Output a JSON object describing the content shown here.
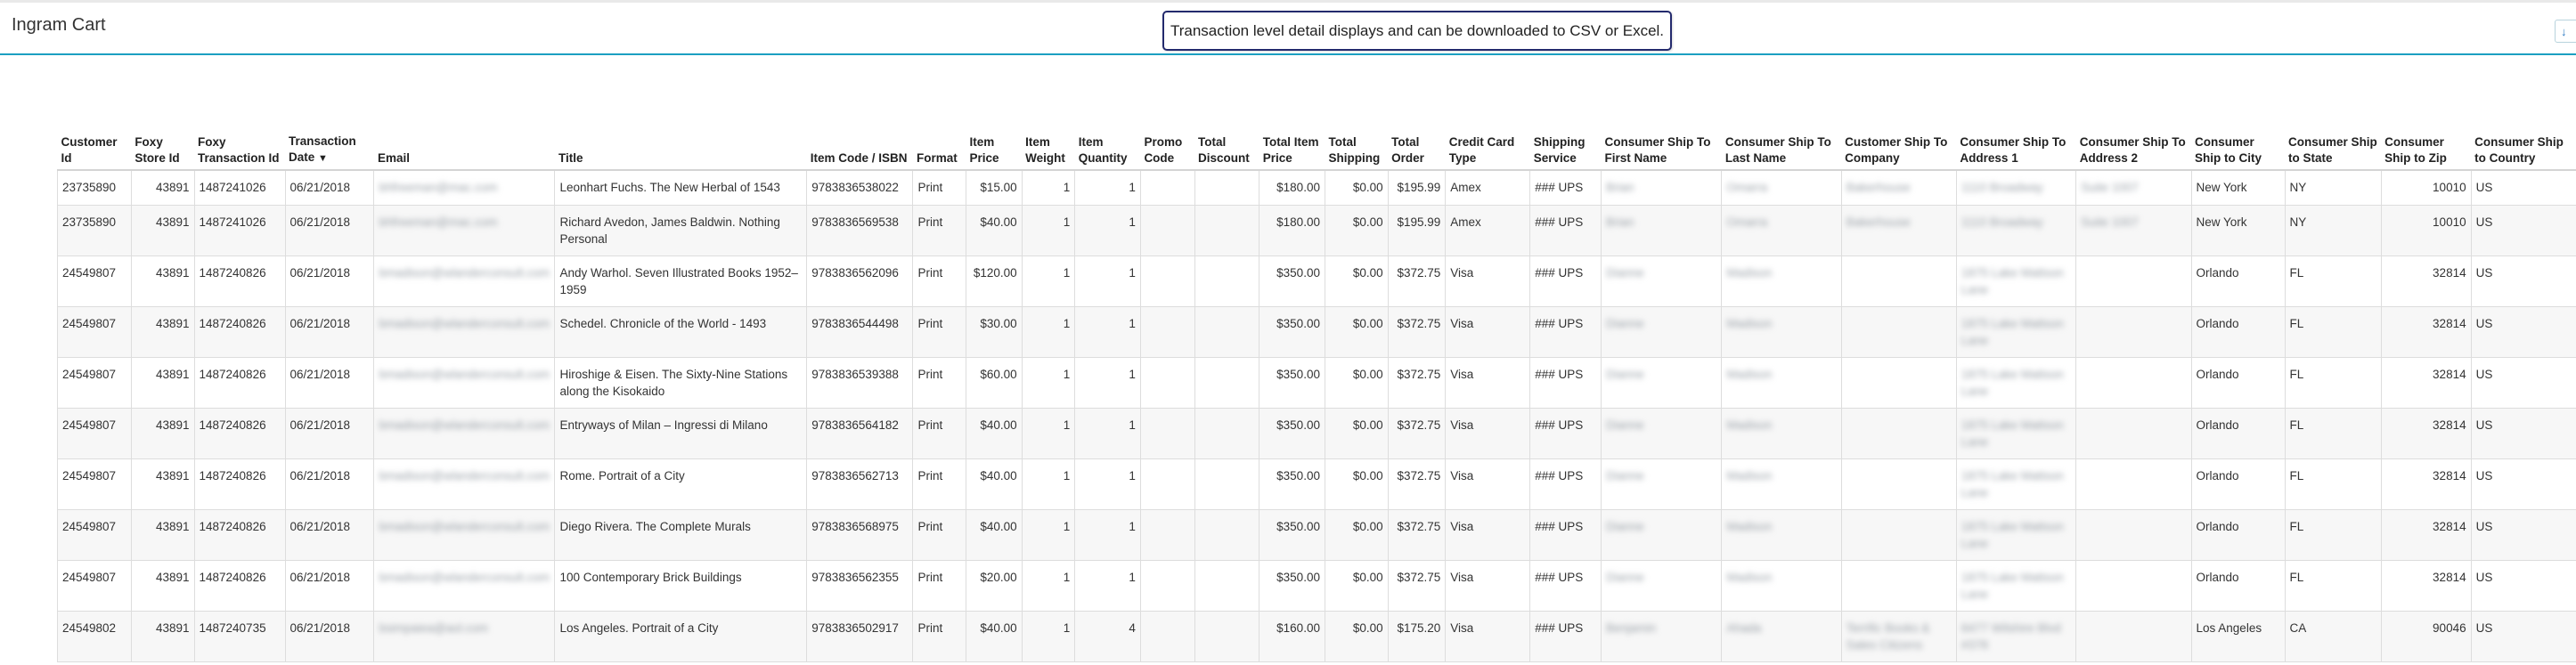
{
  "app": {
    "title": "Ingram Cart"
  },
  "callout": {
    "text": "Transaction level detail displays and can be  downloaded to CSV or Excel."
  },
  "edge_button": {
    "label": "↓"
  },
  "table": {
    "columns": [
      {
        "key": "customer_id",
        "label": "Customer Id",
        "align": "left"
      },
      {
        "key": "store_id",
        "label": "Foxy Store Id",
        "align": "right"
      },
      {
        "key": "txn_id",
        "label": "Foxy Transaction Id",
        "align": "left"
      },
      {
        "key": "txn_date",
        "label": "Transaction Date",
        "align": "left",
        "sort": "▼"
      },
      {
        "key": "email",
        "label": "Email",
        "align": "left",
        "blur": true
      },
      {
        "key": "title",
        "label": "Title",
        "align": "left"
      },
      {
        "key": "isbn",
        "label": "Item Code / ISBN",
        "align": "left"
      },
      {
        "key": "format",
        "label": "Format",
        "align": "left"
      },
      {
        "key": "item_price",
        "label": "Item Price",
        "align": "right"
      },
      {
        "key": "item_weight",
        "label": "Item Weight",
        "align": "right"
      },
      {
        "key": "item_qty",
        "label": "Item Quantity",
        "align": "right"
      },
      {
        "key": "promo",
        "label": "Promo Code",
        "align": "left"
      },
      {
        "key": "discount",
        "label": "Total Discount",
        "align": "left"
      },
      {
        "key": "total_item_price",
        "label": "Total Item Price",
        "align": "right"
      },
      {
        "key": "total_shipping",
        "label": "Total Shipping",
        "align": "right"
      },
      {
        "key": "total_order",
        "label": "Total Order",
        "align": "right"
      },
      {
        "key": "card_type",
        "label": "Credit Card Type",
        "align": "left"
      },
      {
        "key": "ship_service",
        "label": "Shipping Service",
        "align": "left"
      },
      {
        "key": "first_name",
        "label": "Consumer Ship To First Name",
        "align": "left",
        "blur": true
      },
      {
        "key": "last_name",
        "label": "Consumer Ship To Last Name",
        "align": "left",
        "blur": true
      },
      {
        "key": "company",
        "label": "Customer Ship To Company",
        "align": "left",
        "blur": true
      },
      {
        "key": "address1",
        "label": "Consumer Ship To Address 1",
        "align": "left",
        "blur": true
      },
      {
        "key": "address2",
        "label": "Consumer Ship To Address 2",
        "align": "left",
        "blur": true
      },
      {
        "key": "city",
        "label": "Consumer Ship to City",
        "align": "left"
      },
      {
        "key": "state",
        "label": "Consumer Ship to State",
        "align": "left"
      },
      {
        "key": "zip",
        "label": "Consumer Ship to Zip",
        "align": "right"
      },
      {
        "key": "country",
        "label": "Consumer Ship to Country",
        "align": "left"
      }
    ],
    "rows": [
      {
        "short": true,
        "customer_id": "23735890",
        "store_id": "43891",
        "txn_id": "1487241026",
        "txn_date": "06/21/2018",
        "email": "bhfreeman@mac.com",
        "title": "Leonhart Fuchs. The New Herbal of 1543",
        "isbn": "9783836538022",
        "format": "Print",
        "item_price": "$15.00",
        "item_weight": "1",
        "item_qty": "1",
        "promo": "",
        "discount": "",
        "total_item_price": "$180.00",
        "total_shipping": "$0.00",
        "total_order": "$195.99",
        "card_type": "Amex",
        "ship_service": "### UPS",
        "first_name": "Brian",
        "last_name": "Omarra",
        "company": "Bakerhouse",
        "address1": "1110 Broadway",
        "address2": "Suite 1007",
        "city": "New York",
        "state": "NY",
        "zip": "10010",
        "country": "US"
      },
      {
        "short": false,
        "customer_id": "23735890",
        "store_id": "43891",
        "txn_id": "1487241026",
        "txn_date": "06/21/2018",
        "email": "bhfreeman@mac.com",
        "title": "Richard Avedon, James Baldwin. Nothing Personal",
        "isbn": "9783836569538",
        "format": "Print",
        "item_price": "$40.00",
        "item_weight": "1",
        "item_qty": "1",
        "promo": "",
        "discount": "",
        "total_item_price": "$180.00",
        "total_shipping": "$0.00",
        "total_order": "$195.99",
        "card_type": "Amex",
        "ship_service": "### UPS",
        "first_name": "Brian",
        "last_name": "Omarra",
        "company": "Bakerhouse",
        "address1": "1110 Broadway",
        "address2": "Suite 1007",
        "city": "New York",
        "state": "NY",
        "zip": "10010",
        "country": "US"
      },
      {
        "short": false,
        "customer_id": "24549807",
        "store_id": "43891",
        "txn_id": "1487240826",
        "txn_date": "06/21/2018",
        "email": "bmadison@wlanderconsult.com",
        "title": "Andy Warhol. Seven Illustrated Books 1952–1959",
        "isbn": "9783836562096",
        "format": "Print",
        "item_price": "$120.00",
        "item_weight": "1",
        "item_qty": "1",
        "promo": "",
        "discount": "",
        "total_item_price": "$350.00",
        "total_shipping": "$0.00",
        "total_order": "$372.75",
        "card_type": "Visa",
        "ship_service": "### UPS",
        "first_name": "Dianne",
        "last_name": "Madison",
        "company": "",
        "address1": "1875 Lake Mattson Lane",
        "address2": "",
        "city": "Orlando",
        "state": "FL",
        "zip": "32814",
        "country": "US"
      },
      {
        "short": false,
        "customer_id": "24549807",
        "store_id": "43891",
        "txn_id": "1487240826",
        "txn_date": "06/21/2018",
        "email": "bmadison@wlanderconsult.com",
        "title": "Schedel. Chronicle of the World - 1493",
        "isbn": "9783836544498",
        "format": "Print",
        "item_price": "$30.00",
        "item_weight": "1",
        "item_qty": "1",
        "promo": "",
        "discount": "",
        "total_item_price": "$350.00",
        "total_shipping": "$0.00",
        "total_order": "$372.75",
        "card_type": "Visa",
        "ship_service": "### UPS",
        "first_name": "Dianne",
        "last_name": "Madison",
        "company": "",
        "address1": "1875 Lake Mattson Lane",
        "address2": "",
        "city": "Orlando",
        "state": "FL",
        "zip": "32814",
        "country": "US"
      },
      {
        "short": false,
        "customer_id": "24549807",
        "store_id": "43891",
        "txn_id": "1487240826",
        "txn_date": "06/21/2018",
        "email": "bmadison@wlanderconsult.com",
        "title": "Hiroshige & Eisen. The Sixty-Nine Stations along the Kisokaido",
        "isbn": "9783836539388",
        "format": "Print",
        "item_price": "$60.00",
        "item_weight": "1",
        "item_qty": "1",
        "promo": "",
        "discount": "",
        "total_item_price": "$350.00",
        "total_shipping": "$0.00",
        "total_order": "$372.75",
        "card_type": "Visa",
        "ship_service": "### UPS",
        "first_name": "Dianne",
        "last_name": "Madison",
        "company": "",
        "address1": "1875 Lake Mattson Lane",
        "address2": "",
        "city": "Orlando",
        "state": "FL",
        "zip": "32814",
        "country": "US"
      },
      {
        "short": false,
        "customer_id": "24549807",
        "store_id": "43891",
        "txn_id": "1487240826",
        "txn_date": "06/21/2018",
        "email": "bmadison@wlanderconsult.com",
        "title": "Entryways of Milan – Ingressi di Milano",
        "isbn": "9783836564182",
        "format": "Print",
        "item_price": "$40.00",
        "item_weight": "1",
        "item_qty": "1",
        "promo": "",
        "discount": "",
        "total_item_price": "$350.00",
        "total_shipping": "$0.00",
        "total_order": "$372.75",
        "card_type": "Visa",
        "ship_service": "### UPS",
        "first_name": "Dianne",
        "last_name": "Madison",
        "company": "",
        "address1": "1875 Lake Mattson Lane",
        "address2": "",
        "city": "Orlando",
        "state": "FL",
        "zip": "32814",
        "country": "US"
      },
      {
        "short": false,
        "customer_id": "24549807",
        "store_id": "43891",
        "txn_id": "1487240826",
        "txn_date": "06/21/2018",
        "email": "bmadison@wlanderconsult.com",
        "title": "Rome. Portrait of a City",
        "isbn": "9783836562713",
        "format": "Print",
        "item_price": "$40.00",
        "item_weight": "1",
        "item_qty": "1",
        "promo": "",
        "discount": "",
        "total_item_price": "$350.00",
        "total_shipping": "$0.00",
        "total_order": "$372.75",
        "card_type": "Visa",
        "ship_service": "### UPS",
        "first_name": "Dianne",
        "last_name": "Madison",
        "company": "",
        "address1": "1875 Lake Mattson Lane",
        "address2": "",
        "city": "Orlando",
        "state": "FL",
        "zip": "32814",
        "country": "US"
      },
      {
        "short": false,
        "customer_id": "24549807",
        "store_id": "43891",
        "txn_id": "1487240826",
        "txn_date": "06/21/2018",
        "email": "bmadison@wlanderconsult.com",
        "title": "Diego Rivera. The Complete Murals",
        "isbn": "9783836568975",
        "format": "Print",
        "item_price": "$40.00",
        "item_weight": "1",
        "item_qty": "1",
        "promo": "",
        "discount": "",
        "total_item_price": "$350.00",
        "total_shipping": "$0.00",
        "total_order": "$372.75",
        "card_type": "Visa",
        "ship_service": "### UPS",
        "first_name": "Dianne",
        "last_name": "Madison",
        "company": "",
        "address1": "1875 Lake Mattson Lane",
        "address2": "",
        "city": "Orlando",
        "state": "FL",
        "zip": "32814",
        "country": "US"
      },
      {
        "short": false,
        "customer_id": "24549807",
        "store_id": "43891",
        "txn_id": "1487240826",
        "txn_date": "06/21/2018",
        "email": "bmadison@wlanderconsult.com",
        "title": "100 Contemporary Brick Buildings",
        "isbn": "9783836562355",
        "format": "Print",
        "item_price": "$20.00",
        "item_weight": "1",
        "item_qty": "1",
        "promo": "",
        "discount": "",
        "total_item_price": "$350.00",
        "total_shipping": "$0.00",
        "total_order": "$372.75",
        "card_type": "Visa",
        "ship_service": "### UPS",
        "first_name": "Dianne",
        "last_name": "Madison",
        "company": "",
        "address1": "1875 Lake Mattson Lane",
        "address2": "",
        "city": "Orlando",
        "state": "FL",
        "zip": "32814",
        "country": "US"
      },
      {
        "short": false,
        "customer_id": "24549802",
        "store_id": "43891",
        "txn_id": "1487240735",
        "txn_date": "06/21/2018",
        "email": "bsimpaiea@aol.com",
        "title": "Los Angeles. Portrait of a City",
        "isbn": "9783836502917",
        "format": "Print",
        "item_price": "$40.00",
        "item_weight": "1",
        "item_qty": "4",
        "promo": "",
        "discount": "",
        "total_item_price": "$160.00",
        "total_shipping": "$0.00",
        "total_order": "$175.20",
        "card_type": "Visa",
        "ship_service": "### UPS",
        "first_name": "Benjamin",
        "last_name": "Ahada",
        "company": "Terrific Books & Sales Citizens",
        "address1": "6477 Wilshire Blvd #378",
        "address2": "",
        "city": "Los Angeles",
        "state": "CA",
        "zip": "90046",
        "country": "US"
      }
    ]
  }
}
